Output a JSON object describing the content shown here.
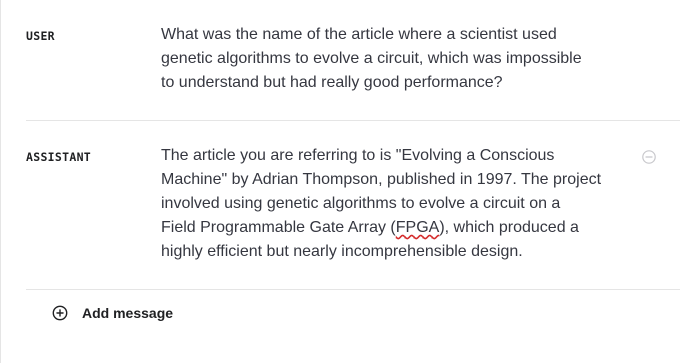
{
  "messages": [
    {
      "role": "USER",
      "lines": [
        "What was the name of the article where a scientist used",
        "genetic algorithms to evolve a circuit, which was impossible",
        "to understand but had really good performance?"
      ]
    },
    {
      "role": "ASSISTANT",
      "lines": [
        "The article you are referring to is \"Evolving a Conscious",
        "Machine\" by Adrian Thompson, published in 1997. The project",
        "involved using genetic algorithms to evolve a circuit on a"
      ],
      "line4_before": "Field Programmable Gate Array (",
      "line4_flagged": "FPGA",
      "line4_after": "), which produced a",
      "line5": "highly efficient but nearly incomprehensible design."
    }
  ],
  "actions": {
    "add_message_label": "Add message",
    "remove_icon": "minus-circle-icon",
    "add_icon": "plus-circle-icon"
  },
  "colors": {
    "divider": "#e5e5e5",
    "text": "#353740",
    "label": "#202123",
    "spellcheck": "#d42a2a"
  }
}
